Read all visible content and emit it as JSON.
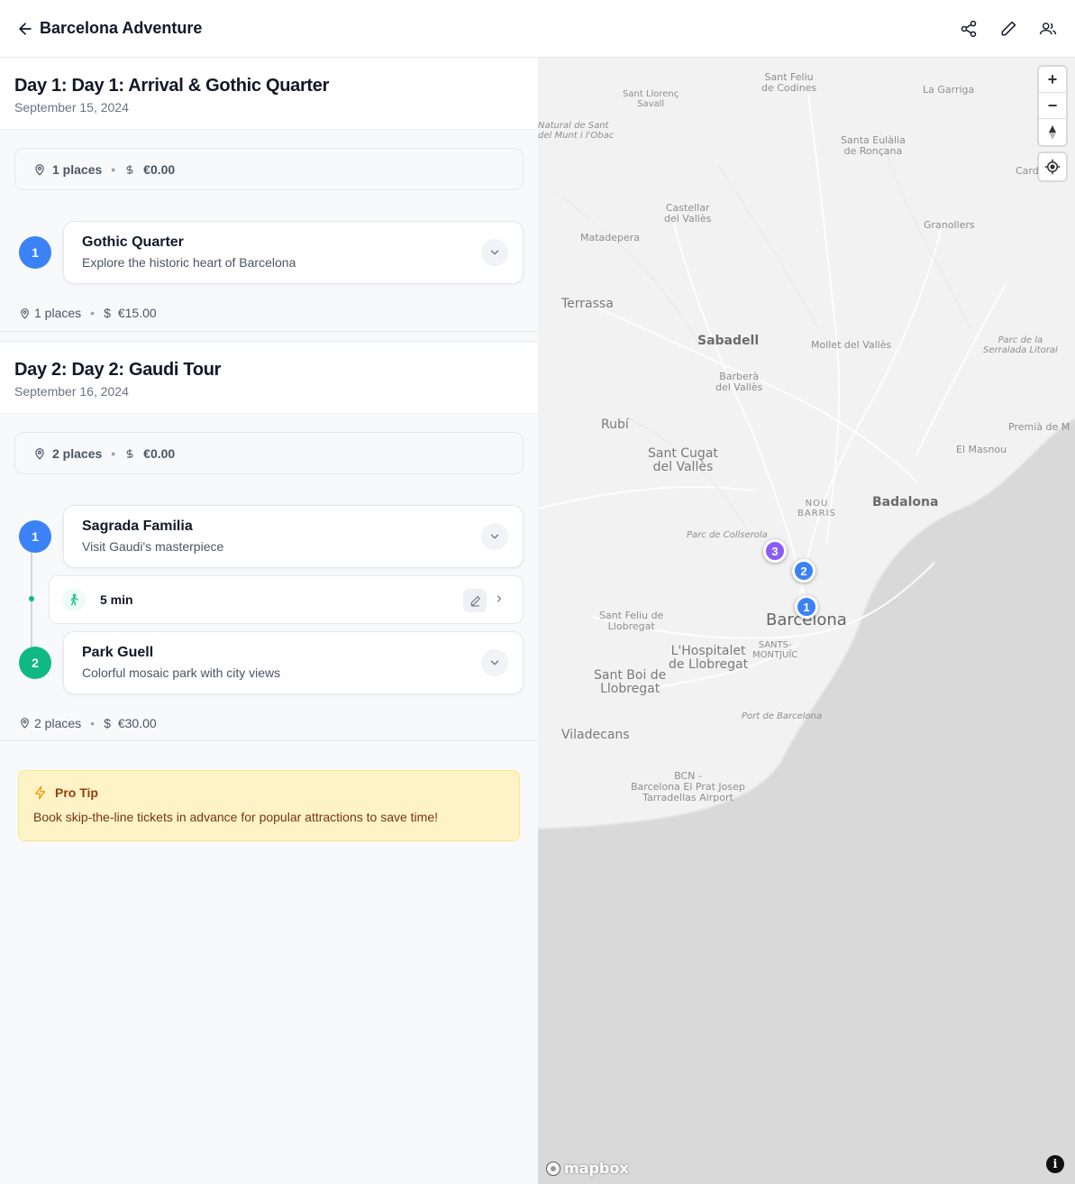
{
  "header": {
    "title": "Barcelona Adventure"
  },
  "days": [
    {
      "title": "Day 1: Day 1: Arrival & Gothic Quarter",
      "date": "September 15, 2024",
      "summary": {
        "places": "1 places",
        "cost": "€0.00"
      },
      "stops": [
        {
          "number": "1",
          "name": "Gothic Quarter",
          "desc": "Explore the historic heart of Barcelona"
        }
      ],
      "footer": {
        "places": "1 places",
        "cost": "€15.00"
      }
    },
    {
      "title": "Day 2: Day 2: Gaudi Tour",
      "date": "September 16, 2024",
      "summary": {
        "places": "2 places",
        "cost": "€0.00"
      },
      "stops": [
        {
          "number": "1",
          "name": "Sagrada Familia",
          "desc": "Visit Gaudi's masterpiece"
        },
        {
          "number": "2",
          "name": "Park Guell",
          "desc": "Colorful mosaic park with city views"
        }
      ],
      "transit": {
        "time": "5 min"
      },
      "footer": {
        "places": "2 places",
        "cost": "€30.00"
      }
    }
  ],
  "tip": {
    "title": "Pro Tip",
    "text": "Book skip-the-line tickets in advance for popular attractions to save time!"
  },
  "map": {
    "labels": {
      "sant_feliu_codines": "Sant Feliu\nde Codines",
      "sant_llorenc": "Sant Llorenç\nSavall",
      "la_garriga": "La Garriga",
      "natural": "Natural de Sant\ndel Munt i l'Obac",
      "santa_eulalia": "Santa Eulàlia\nde Ronçana",
      "cardedeu": "Card",
      "castellar": "Castellar\ndel Vallès",
      "matadepera": "Matadepera",
      "granollers": "Granollers",
      "terrassa": "Terrassa",
      "sabadell": "Sabadell",
      "mollet": "Mollet del Vallès",
      "parc_serralada": "Parc de la\nSerralada Litoral",
      "barbera": "Barberà\ndel Vallès",
      "rubi": "Rubí",
      "premia": "Premià de M",
      "el_masnou": "El Masnou",
      "sant_cugat": "Sant Cugat\ndel Vallès",
      "nou_barris": "NOU\nBARRIS",
      "badalona": "Badalona",
      "collserola": "Parc de Collserola",
      "sant_feliu_llobregat": "Sant Feliu de\nLlobregat",
      "barcelona": "Barcelona",
      "hospitalet": "L'Hospitalet\nde Llobregat",
      "sants": "SANTS-\nMONTJUÏC",
      "sant_boi": "Sant Boi de\nLlobregat",
      "port": "Port de Barcelona",
      "viladecans": "Viladecans",
      "airport": "BCN -\nBarcelona El Prat Josep\nTarradellas Airport"
    },
    "pins": [
      {
        "number": "3",
        "color": "#8b5cf6"
      },
      {
        "number": "2",
        "color": "#3b82f6"
      },
      {
        "number": "1",
        "color": "#3b82f6"
      }
    ],
    "controls": {
      "zoom_in": "+",
      "zoom_out": "−"
    },
    "logo": "mapbox",
    "info": "i"
  },
  "colors": {
    "blue": "#3b82f6",
    "green": "#10b981",
    "purple": "#8b5cf6"
  }
}
